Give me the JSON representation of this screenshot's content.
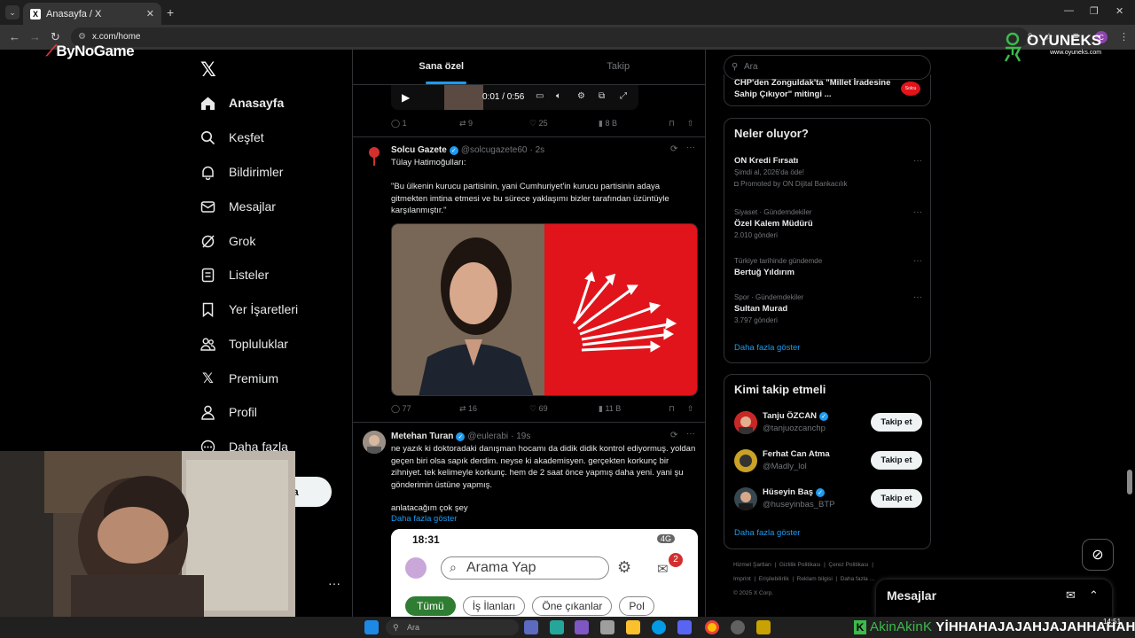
{
  "browser": {
    "tab_title": "Anasayfa / X",
    "url": "x.com/home",
    "profile_initial": "C"
  },
  "overlays": {
    "bynogame_logo": "ByNoGame",
    "oyuneks_name": "OYUNEKS",
    "oyuneks_url": "www.oyuneks.com"
  },
  "nav": {
    "items": [
      {
        "label": "Anasayfa",
        "icon": "home-icon"
      },
      {
        "label": "Keşfet",
        "icon": "search-icon"
      },
      {
        "label": "Bildirimler",
        "icon": "bell-icon"
      },
      {
        "label": "Mesajlar",
        "icon": "mail-icon"
      },
      {
        "label": "Grok",
        "icon": "grok-icon"
      },
      {
        "label": "Listeler",
        "icon": "list-icon"
      },
      {
        "label": "Yer İşaretleri",
        "icon": "bookmark-icon"
      },
      {
        "label": "Topluluklar",
        "icon": "people-icon"
      },
      {
        "label": "Premium",
        "icon": "x-icon"
      },
      {
        "label": "Profil",
        "icon": "user-icon"
      },
      {
        "label": "Daha fazla",
        "icon": "more-icon"
      }
    ],
    "post_button_fragment": "a"
  },
  "feed": {
    "tabs": [
      "Sana özel",
      "Takip"
    ],
    "video": {
      "time": "0:01 / 0:56"
    },
    "tweet0_actions": {
      "replies": "1",
      "reposts": "9",
      "likes": "25",
      "views": "8 B"
    },
    "tweet1": {
      "name": "Solcu Gazete",
      "handle": "@solcugazete60",
      "time": "· 2s",
      "line1": "Tülay Hatimoğulları:",
      "line2": "\"Bu ülkenin kurucu partisinin, yani Cumhuriyet'in kurucu partisinin adaya gitmekten imtina etmesi ve bu sürece yaklaşımı bizler tarafından üzüntüyle karşılanmıştır.\"",
      "actions": {
        "replies": "77",
        "reposts": "16",
        "likes": "69",
        "views": "11 B"
      }
    },
    "tweet2": {
      "name": "Metehan Turan",
      "handle": "@eulerabi",
      "time": "· 19s",
      "text": "ne yazık ki doktoradaki danışman hocamı da didik didik kontrol ediyormuş. yoldan geçen biri olsa sapık derdim. neyse ki akademisyen. gerçekten korkunç bir zihniyet. tek kelimeyle korkunç. hem de 2 saat önce yapmış daha yeni. yani şu gönderimin üstüne yapmış.",
      "text2": "anlatacağım çok şey",
      "show_more": "Daha fazla göster",
      "embedded": {
        "clock": "18:31",
        "search_placeholder": "Arama Yap",
        "badge": "2",
        "status": "4G",
        "chips": [
          "Tümü",
          "İş İlanları",
          "Öne çıkanlar",
          "Pol"
        ]
      }
    }
  },
  "right": {
    "search_placeholder": "Ara",
    "prev_trend": "CHP'den Zonguldak'ta \"Millet İradesine Sahip Çıkıyor\" mitingi ...",
    "trends_title": "Neler oluyor?",
    "trends": [
      {
        "meta": "",
        "title": "ON Kredi Fırsatı",
        "sub": "Şimdi al, 2026'da öde!",
        "sub2": "Promoted by ON Dijital Bankacılık"
      },
      {
        "meta": "Siyaset · Gündemdekiler",
        "title": "Özel Kalem Müdürü",
        "sub": "2.010 gönderi",
        "sub2": ""
      },
      {
        "meta": "Türkiye tarihinde gündemde",
        "title": "Bertuğ Yıldırım",
        "sub": "",
        "sub2": ""
      },
      {
        "meta": "Spor · Gündemdekiler",
        "title": "Sultan Murad",
        "sub": "3.797 gönderi",
        "sub2": ""
      }
    ],
    "trends_more": "Daha fazla göster",
    "who_title": "Kimi takip etmeli",
    "who": [
      {
        "name": "Tanju ÖZCAN",
        "handle": "@tanjuozcanchp",
        "button": "Takip et",
        "verified": true
      },
      {
        "name": "Ferhat Can Atma",
        "handle": "@Madly_lol",
        "button": "Takip et",
        "verified": false
      },
      {
        "name": "Hüseyin Baş",
        "handle": "@huseyinbas_BTP",
        "button": "Takip et",
        "verified": true
      }
    ],
    "who_more": "Daha fazla göster",
    "footer_links": [
      "Hizmet Şartları",
      "Gizlilik Politikası",
      "Çerez Politikası",
      "Imprint",
      "Erişilebilirlik",
      "Reklam bilgisi",
      "Daha fazla ..."
    ],
    "copyright": "© 2025 X Corp.",
    "messages_title": "Mesajlar"
  },
  "taskbar": {
    "search_placeholder": "Ara",
    "clock": "14:51"
  },
  "ticker": {
    "user": "AkinAkinK",
    "text": "YİHHAHAJAJAHJAJAHHAHAHA"
  }
}
